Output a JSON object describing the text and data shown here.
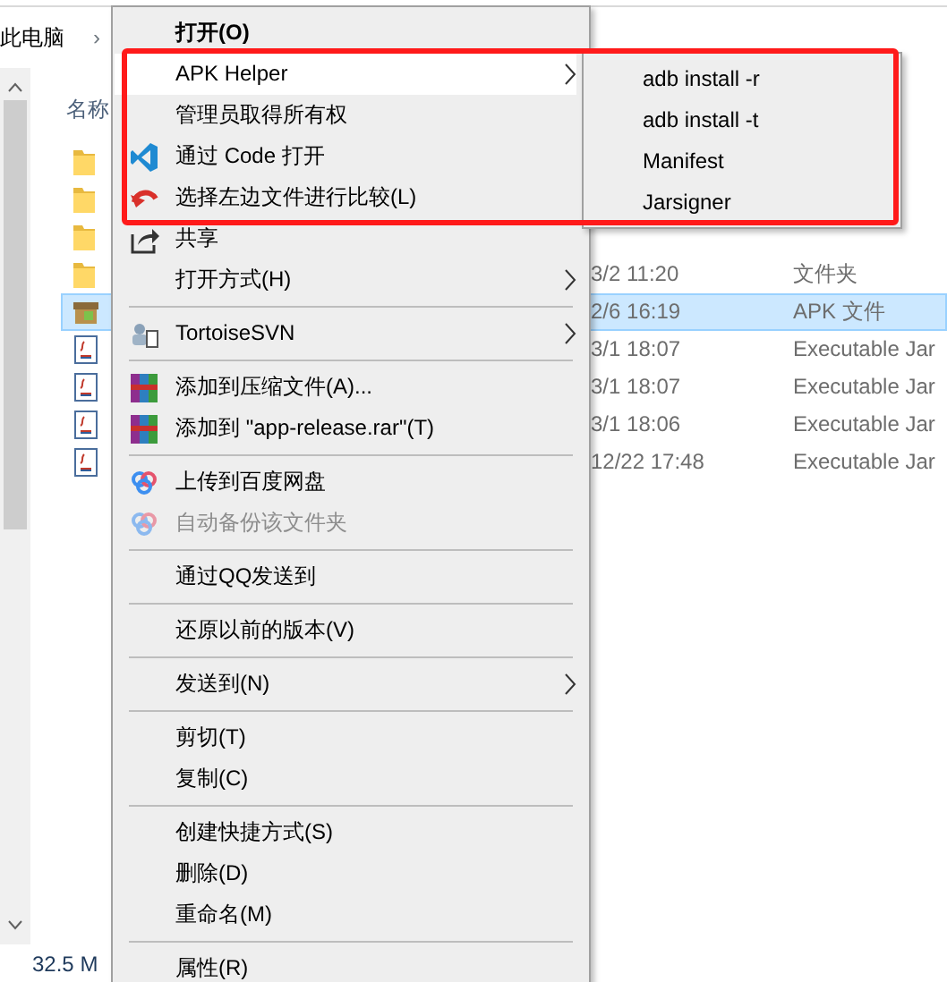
{
  "breadcrumb": {
    "location": "此电脑",
    "separator": "›"
  },
  "file_list": {
    "column_header": "名称",
    "rows": [
      {
        "kind": "folder",
        "selected": false
      },
      {
        "kind": "folder",
        "selected": false
      },
      {
        "kind": "folder",
        "selected": false
      },
      {
        "kind": "folder",
        "selected": false,
        "date": "3/2 11:20",
        "type": "文件夹"
      },
      {
        "kind": "apk",
        "selected": true,
        "date": "2/6 16:19",
        "type": "APK 文件"
      },
      {
        "kind": "jar",
        "selected": false,
        "date": "3/1 18:07",
        "type": "Executable Jar"
      },
      {
        "kind": "jar",
        "selected": false,
        "date": "3/1 18:07",
        "type": "Executable Jar"
      },
      {
        "kind": "jar",
        "selected": false,
        "date": "3/1 18:06",
        "type": "Executable Jar"
      },
      {
        "kind": "jar",
        "selected": false,
        "date": "12/22 17:48",
        "type": "Executable Jar"
      }
    ]
  },
  "status_bar": {
    "size": "32.5 M"
  },
  "context_menu": [
    {
      "kind": "default",
      "label": "打开(O)",
      "selected": false,
      "disabled": false
    },
    {
      "kind": "item",
      "label": "APK Helper",
      "submenu": true,
      "selected": true,
      "disabled": false
    },
    {
      "kind": "item",
      "label": "管理员取得所有权",
      "selected": false,
      "disabled": false
    },
    {
      "kind": "code",
      "label": "通过 Code 打开",
      "selected": false,
      "disabled": false
    },
    {
      "kind": "compare",
      "label": "选择左边文件进行比较(L)",
      "selected": false,
      "disabled": false
    },
    {
      "kind": "share",
      "label": "共享",
      "selected": false,
      "disabled": false
    },
    {
      "kind": "item",
      "label": "打开方式(H)",
      "submenu": true,
      "selected": false,
      "disabled": false
    },
    {
      "kind": "separator"
    },
    {
      "kind": "svn",
      "label": "TortoiseSVN",
      "submenu": true,
      "selected": false,
      "disabled": false
    },
    {
      "kind": "separator"
    },
    {
      "kind": "archive",
      "label": "添加到压缩文件(A)...",
      "selected": false,
      "disabled": false
    },
    {
      "kind": "archive",
      "label": "添加到 \"app-release.rar\"(T)",
      "selected": false,
      "disabled": false
    },
    {
      "kind": "separator"
    },
    {
      "kind": "cloud",
      "label": "上传到百度网盘",
      "selected": false,
      "disabled": false
    },
    {
      "kind": "cloud",
      "label": "自动备份该文件夹",
      "selected": false,
      "disabled": true
    },
    {
      "kind": "separator"
    },
    {
      "kind": "item",
      "label": "通过QQ发送到",
      "selected": false,
      "disabled": false
    },
    {
      "kind": "separator"
    },
    {
      "kind": "item",
      "label": "还原以前的版本(V)",
      "selected": false,
      "disabled": false
    },
    {
      "kind": "separator"
    },
    {
      "kind": "item",
      "label": "发送到(N)",
      "submenu": true,
      "selected": false,
      "disabled": false
    },
    {
      "kind": "separator"
    },
    {
      "kind": "item",
      "label": "剪切(T)",
      "selected": false,
      "disabled": false
    },
    {
      "kind": "item",
      "label": "复制(C)",
      "selected": false,
      "disabled": false
    },
    {
      "kind": "separator"
    },
    {
      "kind": "item",
      "label": "创建快捷方式(S)",
      "selected": false,
      "disabled": false
    },
    {
      "kind": "item",
      "label": "删除(D)",
      "selected": false,
      "disabled": false
    },
    {
      "kind": "item",
      "label": "重命名(M)",
      "selected": false,
      "disabled": false
    },
    {
      "kind": "separator"
    },
    {
      "kind": "item",
      "label": "属性(R)",
      "selected": false,
      "disabled": false
    }
  ],
  "submenu": [
    {
      "label": "adb install -r"
    },
    {
      "label": "adb install -t"
    },
    {
      "label": "Manifest"
    },
    {
      "label": "Jarsigner"
    }
  ]
}
